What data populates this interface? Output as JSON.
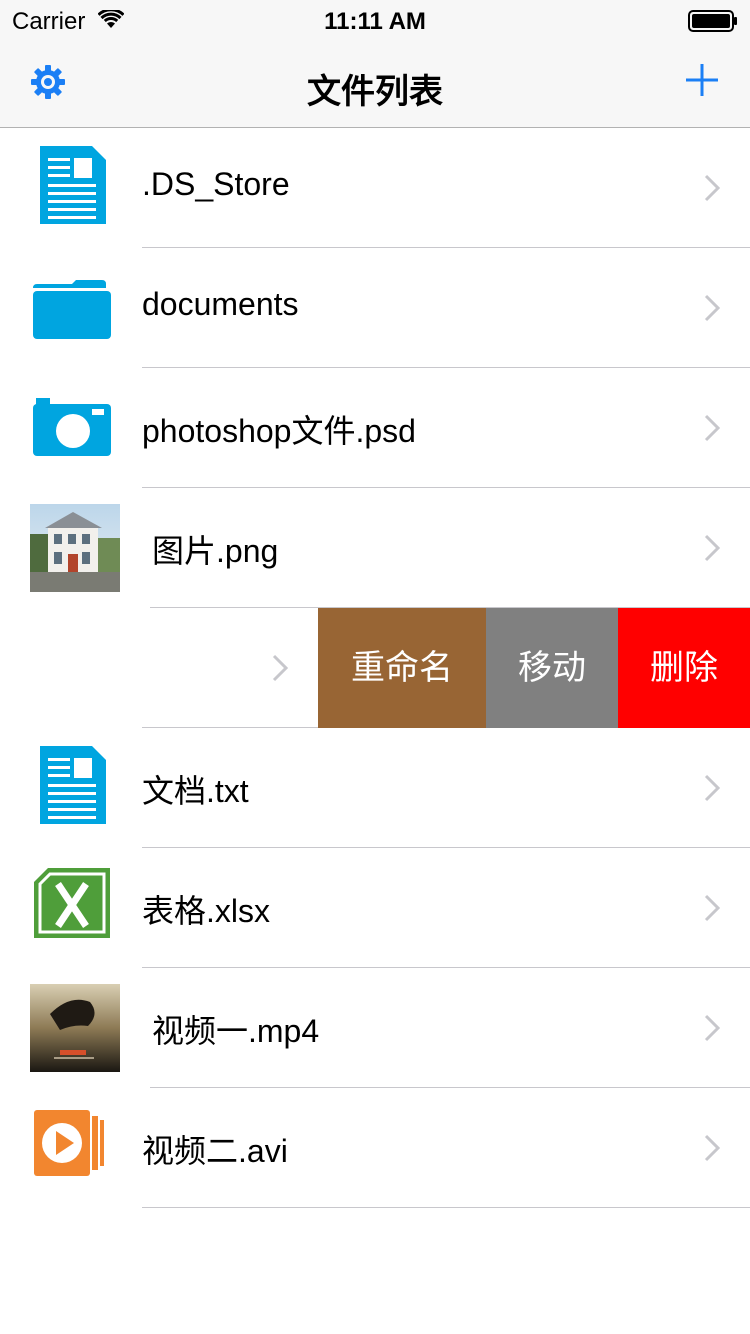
{
  "status_bar": {
    "carrier": "Carrier",
    "time": "11:11 AM"
  },
  "nav": {
    "title": "文件列表",
    "left_icon": "gear-icon",
    "right_icon": "plus-icon"
  },
  "colors": {
    "tint": "#1b7ff5",
    "file_blue": "#00a5e0",
    "rename": "#986534",
    "move": "#808080",
    "delete": "#ff0000"
  },
  "files": [
    {
      "name": ".DS_Store",
      "icon": "document-icon"
    },
    {
      "name": "documents",
      "icon": "folder-icon"
    },
    {
      "name": "photoshop文件.psd",
      "icon": "camera-icon"
    },
    {
      "name": "图片.png",
      "icon": "image-thumbnail"
    },
    {
      "name": "",
      "icon": ""
    },
    {
      "name": "文档.txt",
      "icon": "document-icon"
    },
    {
      "name": "表格.xlsx",
      "icon": "excel-icon"
    },
    {
      "name": "视频一.mp4",
      "icon": "video-thumbnail"
    },
    {
      "name": "视频二.avi",
      "icon": "play-icon"
    }
  ],
  "swipe_actions": {
    "rename": "重命名",
    "move": "移动",
    "delete": "删除"
  }
}
